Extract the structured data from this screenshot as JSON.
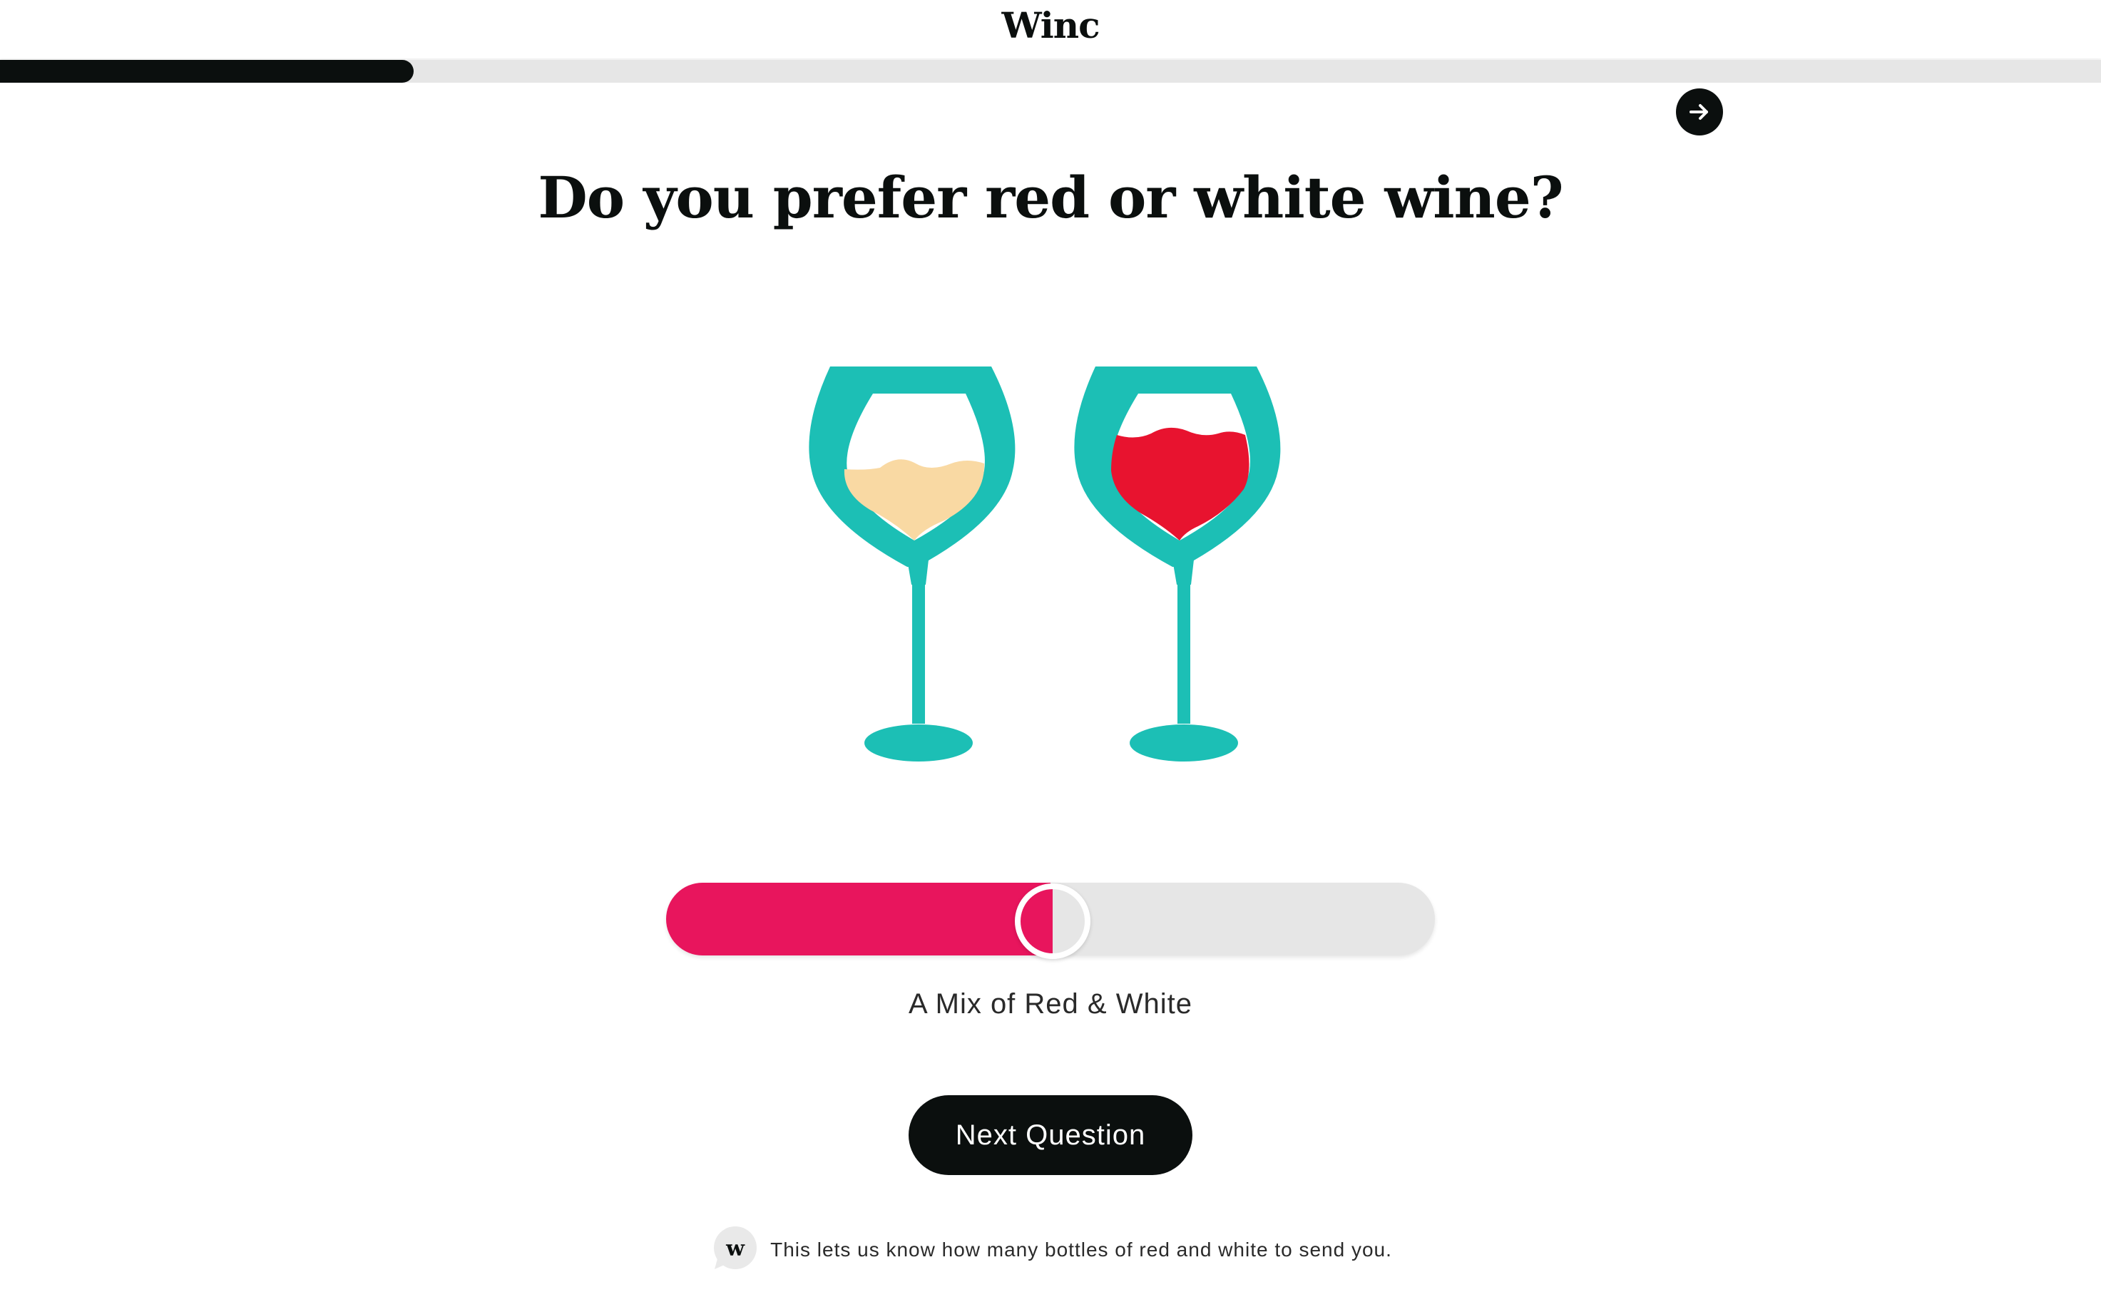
{
  "header": {
    "logo_text": "Winc"
  },
  "progress": {
    "fraction": 0.197
  },
  "nav": {
    "next_arrow_icon": "arrow-right-icon"
  },
  "question": {
    "title": "Do you prefer red or white wine?"
  },
  "illustration": {
    "glasses": [
      {
        "name": "white-wine-glass",
        "wine_color": "#f9d9a3"
      },
      {
        "name": "red-wine-glass",
        "wine_color": "#e8132f"
      }
    ],
    "glass_color": "#1cbfb5"
  },
  "slider": {
    "value_fraction": 0.5,
    "value_label": "A Mix of Red & White",
    "fill_color": "#e8155d",
    "track_color": "#e6e6e6"
  },
  "actions": {
    "next_question_label": "Next Question"
  },
  "hint": {
    "avatar_icon": "winc-w-speech-bubble-icon",
    "text": "This lets us know how many bottles of red and white to send you."
  }
}
